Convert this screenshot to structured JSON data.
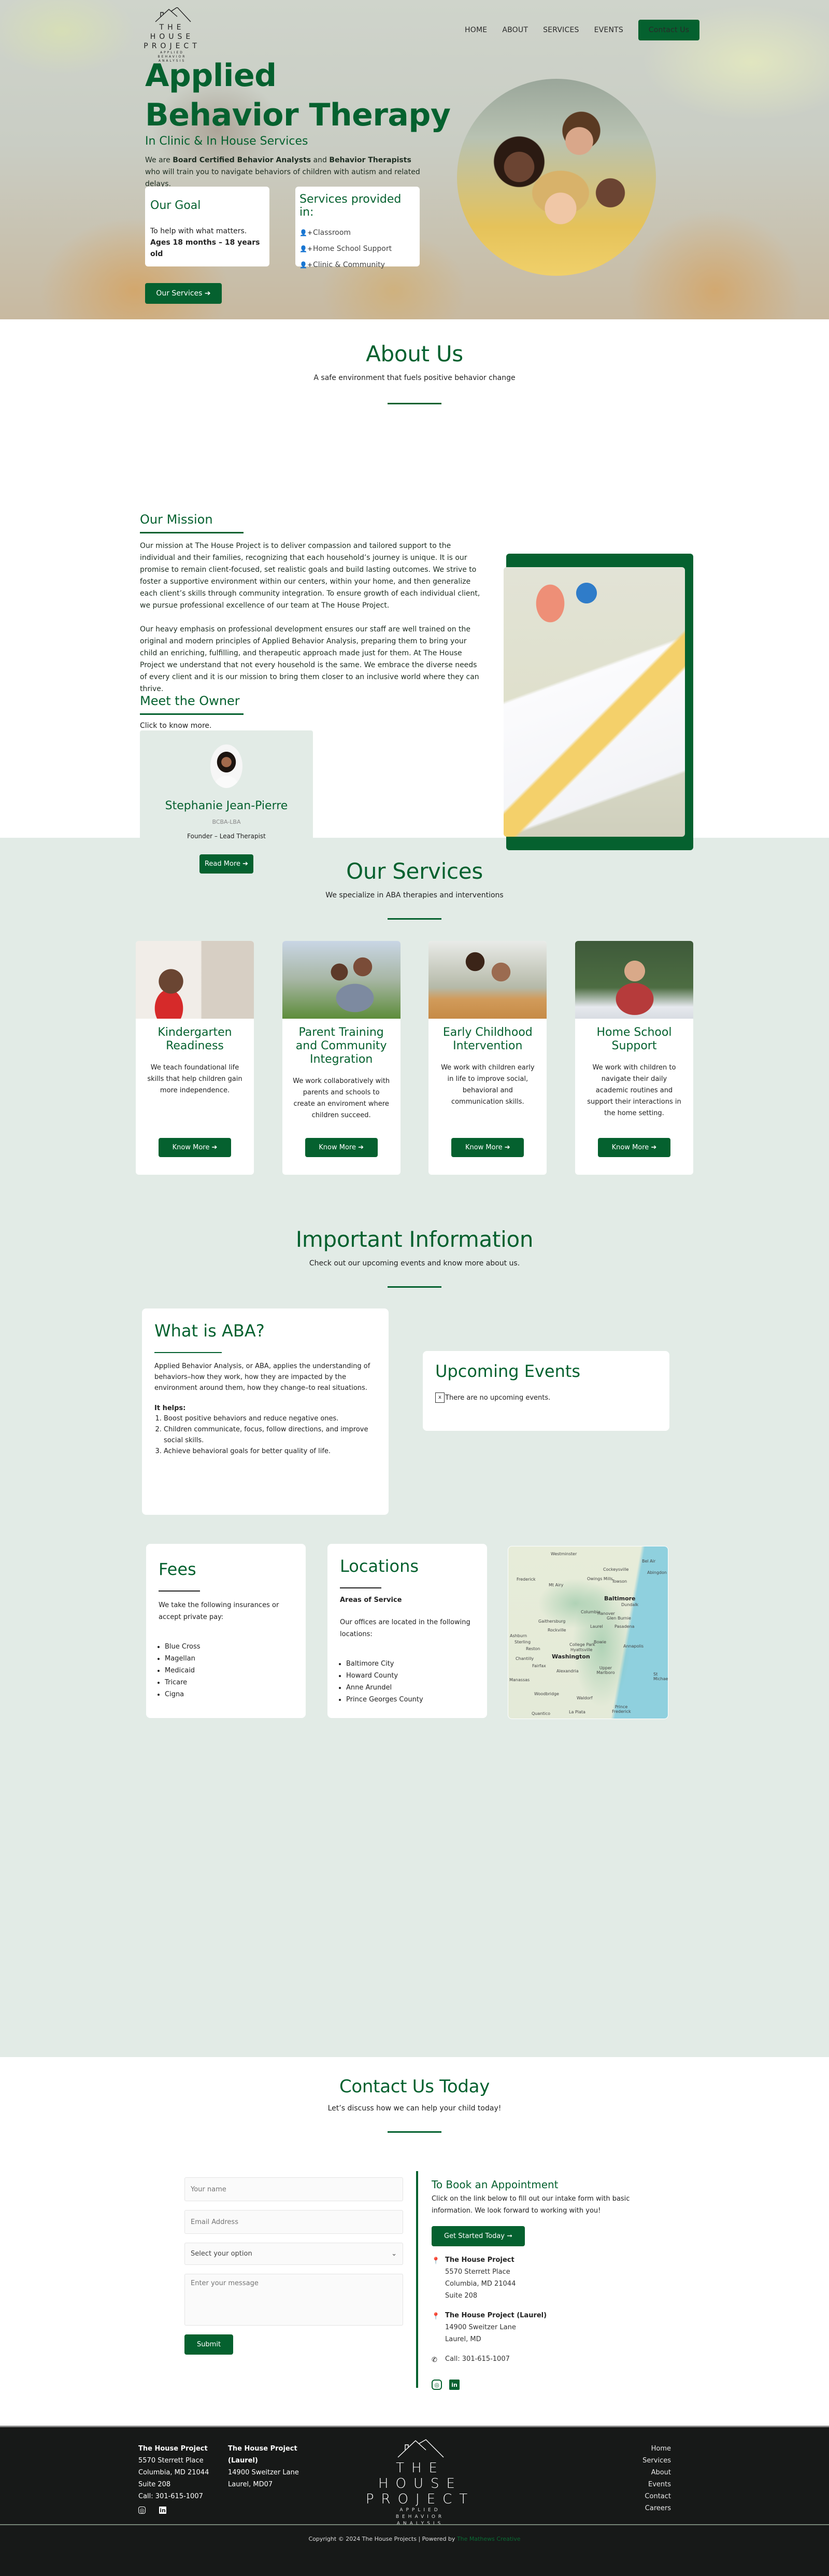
{
  "brand": {
    "line1": "THE HOUSE",
    "line2": "PROJECT",
    "tag1": "APPLIED",
    "tag2": "BEHAVIOR",
    "tag3": "ANALYSIS"
  },
  "colors": {
    "accent": "#05612f",
    "light_bg": "#e2ebe6",
    "footer_bg": "#171918"
  },
  "nav": {
    "items": [
      "HOME",
      "ABOUT",
      "SERVICES",
      "EVENTS"
    ],
    "cta": "Contact Us"
  },
  "hero": {
    "title_line1": "Applied",
    "title_line2": "Behavior Therapy",
    "subtitle": "In Clinic & In House Services",
    "desc_pre": "We are ",
    "desc_b1": "Board Certified Behavior Analysts",
    "desc_mid": " and ",
    "desc_b2": "Behavior Therapists",
    "desc_post": " who will train you to navigate behaviors of children with autism and related delays.",
    "goal": {
      "title": "Our Goal",
      "text": "To help with what matters.",
      "ages": "Ages 18 months – 18 years old"
    },
    "services_in": {
      "title": "Services provided in:",
      "icon": "user-plus-icon",
      "items": [
        "Classroom",
        "Home School Support",
        "Clinic & Community"
      ]
    },
    "cta": "Our Services ➔"
  },
  "about": {
    "title": "About Us",
    "subtitle": "A safe environment that fuels positive behavior change",
    "mission_title": "Our Mission",
    "mission_p1": "Our mission at The House Project is to deliver compassion and tailored support to the individual and their families, recognizing that each household’s journey is unique. It is our promise to remain client-focused, set realistic goals and build lasting outcomes. We strive to foster a supportive environment within our centers, within your home, and then generalize each client’s skills through community integration. To ensure growth of each individual client, we pursue professional excellence of our team at The House Project.",
    "mission_p2": "Our heavy emphasis on professional development ensures our staff are well trained on the original and modern principles of Applied Behavior Analysis, preparing them to bring your child an enriching, fulfilling, and therapeutic approach made just for them. At The House Project we understand that not every household is the same. We embrace the diverse needs of every client and it is our mission to bring them closer to an inclusive world where they can thrive.",
    "owner_title": "Meet the Owner",
    "owner_hint": "Click to know more.",
    "owner": {
      "name": "Stephanie Jean-Pierre",
      "cred": "BCBA-LBA",
      "role": "Founder – Lead Therapist",
      "cta": "Read More ➔"
    }
  },
  "services": {
    "title": "Our Services",
    "subtitle": "We specialize in ABA therapies and interventions",
    "cards": [
      {
        "title": "Kindergarten Readiness",
        "text": "We teach foundational life skills that help children gain more independence.",
        "cta": "Know More ➔"
      },
      {
        "title": "Parent Training and Community Integration",
        "text": "We work collaboratively with parents and schools to create an enviroment where children succeed.",
        "cta": "Know More ➔"
      },
      {
        "title": "Early Childhood Intervention",
        "text": "We work with children early in life to improve social, behavioral and communication skills.",
        "cta": "Know More ➔"
      },
      {
        "title": "Home School Support",
        "text": "We work with children to navigate their daily academic routines and support their interactions in the home setting.",
        "cta": "Know More ➔"
      }
    ]
  },
  "info": {
    "title": "Important Information",
    "subtitle": "Check out our upcoming events and know more about us.",
    "aba": {
      "title": "What is ABA?",
      "text": "Applied Behavior Analysis, or ABA, applies the understanding of behaviors–how they work, how they are impacted by the environment around them, how they change–to real situations.",
      "helps": "It helps:",
      "list": [
        "Boost positive behaviors and reduce negative ones.",
        "Children communicate, focus, follow directions, and improve social skills.",
        "Achieve behavioral goals for better quality of life."
      ]
    },
    "events": {
      "title": "Upcoming Events",
      "empty": "There are no upcoming events."
    },
    "fees": {
      "title": "Fees",
      "text": "We take the following insurances or accept private pay:",
      "list": [
        "Blue Cross",
        "Magellan",
        "Medicaid",
        "Tricare",
        "Cigna"
      ]
    },
    "locations": {
      "title": "Locations",
      "areas": "Areas of Service",
      "text": "Our offices are located in the following locations:",
      "list": [
        "Baltimore City",
        "Howard County",
        "Anne Arundel",
        "Prince Georges County"
      ]
    },
    "map_labels": [
      "Westminster",
      "Bel Air",
      "Cockeysville",
      "Abingdon",
      "Frederick",
      "Owings Mills",
      "Towson",
      "Mt Airy",
      "Baltimore",
      "Dundalk",
      "Columbia",
      "Hanover",
      "Glen Burnie",
      "Gaithersburg",
      "Laurel",
      "Pasadena",
      "Rockville",
      "Ashburn",
      "Sterling",
      "Bowie",
      "College Park",
      "Hyattsville",
      "Annapolis",
      "Reston",
      "Washington",
      "Chantilly",
      "Fairfax",
      "Alexandria",
      "Upper Marlboro",
      "Manassas",
      "St Michaels",
      "Woodbridge",
      "Waldorf",
      "Quantico",
      "La Plata",
      "Prince Frederick"
    ]
  },
  "contact": {
    "title": "Contact Us Today",
    "subtitle": "Let’s discuss how we can help your child today!",
    "form": {
      "name_ph": "Your name",
      "email_ph": "Email Address",
      "select": "Select your option",
      "message_ph": "Enter your message",
      "submit": "Submit"
    },
    "book": {
      "title": "To Book an Appointment",
      "text": "Click on the link below to fill out our intake form with basic information. We look forward to working with you!",
      "cta": "Get Started Today ➞"
    },
    "loc1": {
      "name": "The House Project",
      "l1": "5570 Sterrett Place",
      "l2": "Columbia, MD 21044",
      "l3": "Suite 208"
    },
    "loc2": {
      "name": "The House Project (Laurel)",
      "l1": "14900 Sweitzer Lane",
      "l2": "Laurel, MD"
    },
    "phone": "Call: 301-615-1007"
  },
  "footer": {
    "col1": {
      "name": "The House Project",
      "l1": "5570 Sterrett Place",
      "l2": "Columbia, MD 21044",
      "l3": "Suite 208",
      "l4": "Call: 301-615-1007"
    },
    "col2": {
      "name1": "The House Project",
      "name2": "(Laurel)",
      "l1": "14900 Sweitzer Lane",
      "l2": "Laurel, MD07"
    },
    "nav": [
      "Home",
      "Services",
      "About",
      "Events",
      "Contact",
      "Careers"
    ],
    "copyright": "Copyright © 2024 The House Projects | Powered by ",
    "powered": "The Mathews Creative"
  }
}
